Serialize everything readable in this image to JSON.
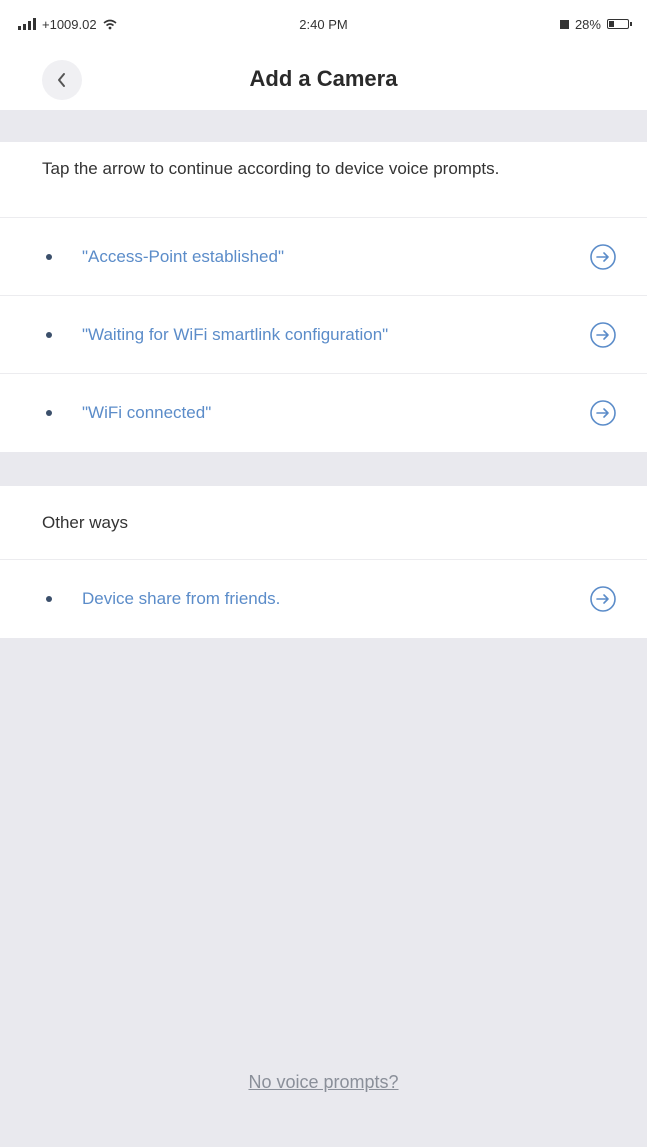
{
  "status_bar": {
    "carrier": "+1009.02",
    "time": "2:40 PM",
    "battery_percent": "28%",
    "battery_level": 0.28
  },
  "nav": {
    "title": "Add a Camera"
  },
  "instruction": "Tap the arrow to continue according to device voice prompts.",
  "prompts": [
    {
      "label": "\"Access-Point established\""
    },
    {
      "label": "\"Waiting for WiFi smartlink configuration\""
    },
    {
      "label": "\"WiFi connected\""
    }
  ],
  "other_ways": {
    "header": "Other ways",
    "items": [
      {
        "label": "Device share from friends."
      }
    ]
  },
  "footer": {
    "no_voice_link": "No voice prompts?"
  },
  "colors": {
    "accent": "#5b8cc9",
    "background": "#e9e9ee",
    "bullet": "#3b4f6b"
  },
  "icons": {
    "back": "chevron-left-icon",
    "row_action": "circle-arrow-right-icon",
    "wifi": "wifi-icon",
    "signal": "signal-icon",
    "battery": "battery-icon"
  }
}
